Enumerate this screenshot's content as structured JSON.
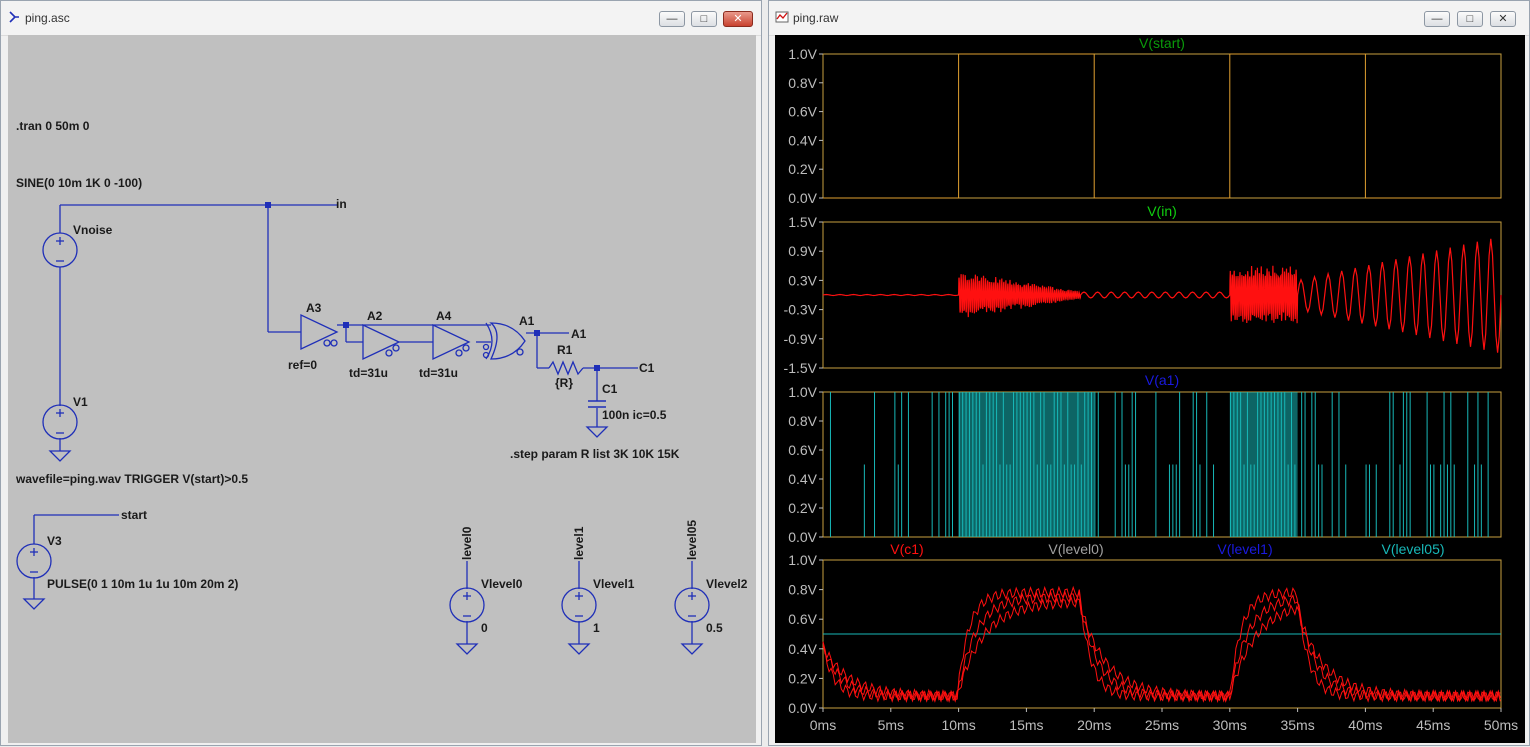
{
  "schematic_window": {
    "title": "ping.asc",
    "colors": {
      "canvas": "#c0c0c0",
      "wire": "#1f2fb8",
      "text": "#111111"
    },
    "directives": {
      "tran": ".tran 0 50m 0",
      "sine": "SINE(0 10m 1K 0 -100)",
      "wavefile": "wavefile=ping.wav TRIGGER V(start)>0.5",
      "pulse": "PULSE(0 1 10m 1u 1u 10m 20m 2)",
      "step": ".step param R list 3K 10K 15K"
    },
    "components": {
      "vnoise": "Vnoise",
      "v1": "V1",
      "v3": "V3",
      "a3": "A3",
      "a3_param": "ref=0",
      "a2": "A2",
      "a2_param": "td=31u",
      "a4": "A4",
      "a4_param": "td=31u",
      "a1": "A1",
      "r1": "R1",
      "r1_value": "{R}",
      "c1": "C1",
      "c1_value": "100n ic=0.5",
      "vlevel0": "Vlevel0",
      "vlevel0_value": "0",
      "vlevel1": "Vlevel1",
      "vlevel1_value": "1",
      "vlevel2": "Vlevel2",
      "vlevel2_value": "0.5"
    },
    "net_labels": {
      "in": "in",
      "a1": "A1",
      "c1": "C1",
      "start": "start",
      "level0": "level0",
      "level1": "level1",
      "level05": "level05"
    }
  },
  "waveform_window": {
    "title": "ping.raw",
    "colors": {
      "background": "#000000",
      "frame": "#c8a040",
      "ticks": "#bdbdbd",
      "start": "#e0a030",
      "in": "#ff1010",
      "a1": "#18b8b8",
      "c1": "#ff1010",
      "level05": "#18b8b8"
    }
  },
  "chart_data": [
    {
      "type": "line",
      "title": "V(start)",
      "title_color": "#0a9a0a",
      "series": [
        {
          "name": "V(start)",
          "color": "#e0a030",
          "x": [
            0,
            10,
            10,
            20,
            20,
            30,
            30,
            40,
            40,
            50
          ],
          "y": [
            0,
            0,
            1,
            1,
            0,
            0,
            1,
            1,
            0,
            0
          ]
        }
      ],
      "x_unit": "ms",
      "yticks": [
        "1.0V",
        "0.8V",
        "0.6V",
        "0.4V",
        "0.2V",
        "0.0V"
      ],
      "ylim": [
        0,
        1
      ]
    },
    {
      "type": "line",
      "title": "V(in)",
      "title_color": "#10d010",
      "series": [
        {
          "name": "V(in)",
          "color": "#ff1010",
          "segments": [
            {
              "x0": 0,
              "x1": 10,
              "amplitude": 0.01,
              "cycles": 10
            },
            {
              "x0": 10,
              "x1": 19,
              "amplitude": 0.5,
              "cycles": 60,
              "decay": true
            },
            {
              "x0": 19,
              "x1": 30,
              "amplitude": 0.06,
              "cycles": 11
            },
            {
              "x0": 30,
              "x1": 35,
              "amplitude": 0.6,
              "cycles": 35
            },
            {
              "x0": 35,
              "x1": 50,
              "amplitude_start": 0.3,
              "amplitude_end": 1.2,
              "cycles": 15
            }
          ]
        }
      ],
      "x_unit": "ms",
      "yticks": [
        "1.5V",
        "0.9V",
        "0.3V",
        "-0.3V",
        "-0.9V",
        "-1.5V"
      ],
      "ylim": [
        -1.5,
        1.5
      ]
    },
    {
      "type": "line",
      "title": "V(a1)",
      "title_color": "#1a1ae0",
      "series": [
        {
          "name": "V(a1)",
          "color": "#18b8b8",
          "levels": [
            0,
            0.5,
            1
          ],
          "dense_ranges": [
            [
              10,
              20
            ],
            [
              30,
              35
            ]
          ]
        }
      ],
      "x_unit": "ms",
      "yticks": [
        "1.0V",
        "0.8V",
        "0.6V",
        "0.4V",
        "0.2V",
        "0.0V"
      ],
      "ylim": [
        0,
        1
      ]
    },
    {
      "type": "line",
      "legend": [
        {
          "label": "V(c1)",
          "color": "#ff1010"
        },
        {
          "label": "V(level0)",
          "color": "#a0a0a0"
        },
        {
          "label": "V(level1)",
          "color": "#1a1ae0"
        },
        {
          "label": "V(level05)",
          "color": "#18b8b8"
        }
      ],
      "series": [
        {
          "name": "V(level05)",
          "color": "#18b8b8",
          "x": [
            0,
            50
          ],
          "y": [
            0.5,
            0.5
          ]
        },
        {
          "name": "V(c1)",
          "color": "#ff1010",
          "high_level": 0.78,
          "low_level": 0.08,
          "rise": [
            [
              10,
              12.5
            ],
            [
              30,
              33
            ]
          ],
          "fall": [
            [
              19,
              22.5
            ],
            [
              35,
              39
            ]
          ]
        }
      ],
      "x_unit": "ms",
      "xticks": [
        "0ms",
        "5ms",
        "10ms",
        "15ms",
        "20ms",
        "25ms",
        "30ms",
        "35ms",
        "40ms",
        "45ms",
        "50ms"
      ],
      "yticks": [
        "1.0V",
        "0.8V",
        "0.6V",
        "0.4V",
        "0.2V",
        "0.0V"
      ],
      "ylim": [
        0,
        1
      ],
      "xlim": [
        0,
        50
      ]
    }
  ]
}
